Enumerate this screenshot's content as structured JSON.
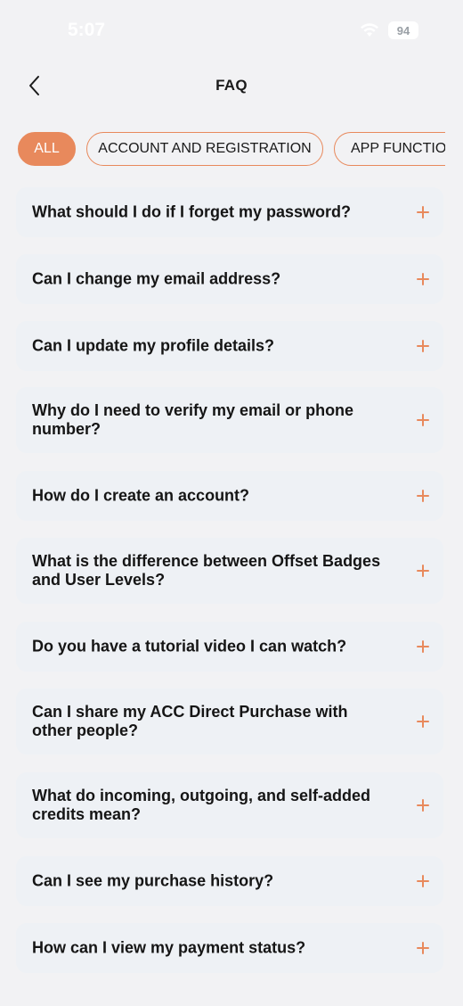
{
  "status_bar": {
    "time": "5:07",
    "battery": "94"
  },
  "header": {
    "title": "FAQ"
  },
  "tabs": [
    {
      "label": "ALL",
      "active": true
    },
    {
      "label": "ACCOUNT AND REGISTRATION",
      "active": false
    },
    {
      "label": "APP FUNCTION",
      "active": false
    }
  ],
  "faqs": [
    {
      "question": "What should I do if I forget my password?"
    },
    {
      "question": "Can I change my email address?"
    },
    {
      "question": "Can I update my profile details?"
    },
    {
      "question": "Why do I need to verify my email or phone number?"
    },
    {
      "question": "How do I create an account?"
    },
    {
      "question": "What is the difference between Offset Badges and User Levels?"
    },
    {
      "question": "Do you have a tutorial video I can watch?"
    },
    {
      "question": "Can I share my ACC Direct Purchase with other people?"
    },
    {
      "question": "What do incoming, outgoing, and self-added credits mean?"
    },
    {
      "question": "Can I see my purchase history?"
    },
    {
      "question": "How can I view my payment status?"
    }
  ],
  "colors": {
    "accent": "#e8895c",
    "card": "#eef1f5",
    "background": "#f2f2f4"
  }
}
